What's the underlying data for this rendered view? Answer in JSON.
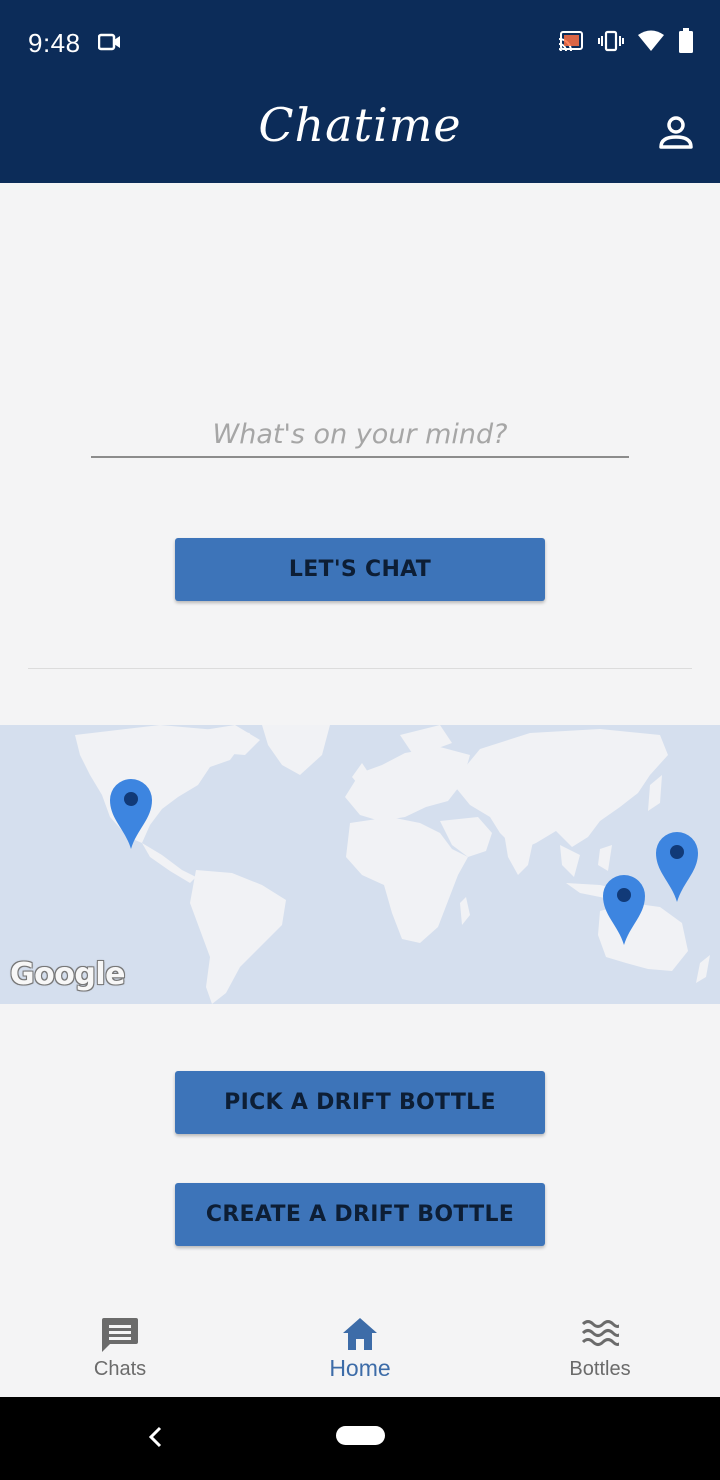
{
  "status_bar": {
    "time": "9:48"
  },
  "app_bar": {
    "title": "Chatime"
  },
  "prompt": {
    "placeholder": "What's on your mind?",
    "value": ""
  },
  "buttons": {
    "lets_chat": "LET'S CHAT",
    "pick_bottle": "PICK A DRIFT BOTTLE",
    "create_bottle": "CREATE A DRIFT BOTTLE"
  },
  "map": {
    "attribution": "Google",
    "marker_color": "#3d85e0",
    "marker_count": 3
  },
  "bottom_nav": {
    "items": [
      {
        "label": "Chats",
        "icon": "chat-icon",
        "active": false
      },
      {
        "label": "Home",
        "icon": "home-icon",
        "active": true
      },
      {
        "label": "Bottles",
        "icon": "waves-icon",
        "active": false
      }
    ]
  },
  "colors": {
    "primary_dark": "#0c2c59",
    "button": "#3d74b9",
    "active_nav": "#3d6ca8"
  }
}
